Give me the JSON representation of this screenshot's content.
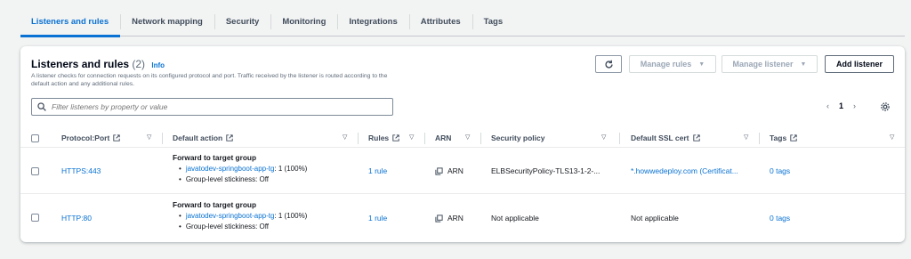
{
  "tabs": [
    {
      "label": "Listeners and rules",
      "active": true
    },
    {
      "label": "Network mapping"
    },
    {
      "label": "Security"
    },
    {
      "label": "Monitoring"
    },
    {
      "label": "Integrations"
    },
    {
      "label": "Attributes"
    },
    {
      "label": "Tags"
    }
  ],
  "panel": {
    "title": "Listeners and rules",
    "count": "(2)",
    "info": "Info",
    "description": "A listener checks for connection requests on its configured protocol and port. Traffic received by the listener is routed according to the default action and any additional rules.",
    "buttons": {
      "manage_rules": "Manage rules",
      "manage_listener": "Manage listener",
      "add_listener": "Add listener"
    },
    "search_placeholder": "Filter listeners by property or value",
    "page": "1"
  },
  "columns": {
    "protocol_port": "Protocol:Port",
    "default_action": "Default action",
    "rules": "Rules",
    "arn": "ARN",
    "security_policy": "Security policy",
    "ssl_cert": "Default SSL cert",
    "tags": "Tags"
  },
  "rows": [
    {
      "protocol_port": "HTTPS:443",
      "action_title": "Forward to target group",
      "target_group": "javatodev-springboot-app-tg",
      "target_weight": ": 1 (100%)",
      "stickiness": "Group-level stickiness: Off",
      "rules": "1 rule",
      "arn": "ARN",
      "security_policy": "ELBSecurityPolicy-TLS13-1-2-...",
      "ssl_cert": "*.howwedeploy.com (Certificat...",
      "tags": "0 tags"
    },
    {
      "protocol_port": "HTTP:80",
      "action_title": "Forward to target group",
      "target_group": "javatodev-springboot-app-tg",
      "target_weight": ": 1 (100%)",
      "stickiness": "Group-level stickiness: Off",
      "rules": "1 rule",
      "arn": "ARN",
      "security_policy": "Not applicable",
      "ssl_cert": "Not applicable",
      "tags": "0 tags"
    }
  ],
  "icons": {
    "refresh": "refresh-icon",
    "search": "search-icon",
    "settings": "gear-icon",
    "external": "external-link-icon",
    "copy": "copy-icon"
  },
  "colors": {
    "accent": "#0972d3",
    "text": "#16191f",
    "muted": "#5f6b7a"
  }
}
